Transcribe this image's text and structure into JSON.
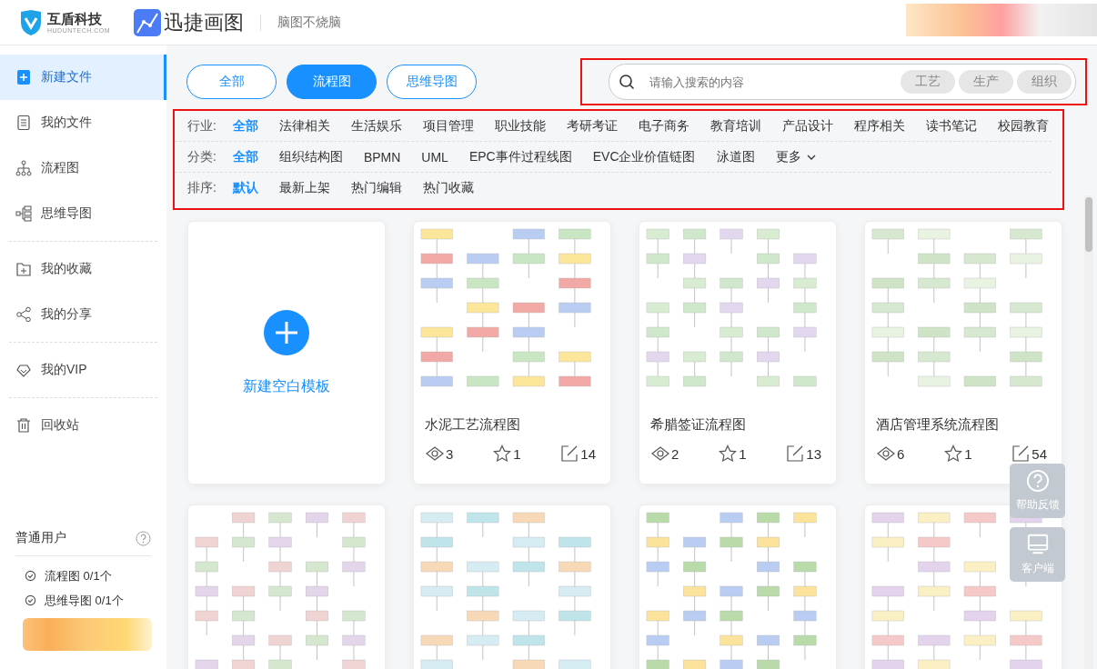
{
  "header": {
    "company_name": "互盾科技",
    "company_domain": "HUDUNTECH.COM",
    "app_name": "迅捷画图",
    "slogan": "脑图不烧脑"
  },
  "sidebar": {
    "groups": [
      [
        {
          "label": "新建文件",
          "selected": true
        },
        {
          "label": "我的文件",
          "selected": false
        },
        {
          "label": "流程图",
          "selected": false
        },
        {
          "label": "思维导图",
          "selected": false
        }
      ],
      [
        {
          "label": "我的收藏",
          "selected": false
        },
        {
          "label": "我的分享",
          "selected": false
        }
      ],
      [
        {
          "label": "我的VIP",
          "selected": false
        }
      ],
      [
        {
          "label": "回收站",
          "selected": false
        }
      ]
    ],
    "user_panel": {
      "title": "普通用户",
      "quotas": [
        "流程图 0/1个",
        "思维导图 0/1个"
      ]
    }
  },
  "type_tabs": [
    {
      "label": "全部",
      "selected": false
    },
    {
      "label": "流程图",
      "selected": true
    },
    {
      "label": "思维导图",
      "selected": false
    }
  ],
  "search": {
    "placeholder": "请输入搜索的内容",
    "tags": [
      "工艺",
      "生产",
      "组织"
    ]
  },
  "filters": [
    {
      "label": "行业:",
      "options": [
        {
          "label": "全部",
          "selected": true
        },
        {
          "label": "法律相关",
          "selected": false
        },
        {
          "label": "生活娱乐",
          "selected": false
        },
        {
          "label": "项目管理",
          "selected": false
        },
        {
          "label": "职业技能",
          "selected": false
        },
        {
          "label": "考研考证",
          "selected": false
        },
        {
          "label": "电子商务",
          "selected": false
        },
        {
          "label": "教育培训",
          "selected": false
        },
        {
          "label": "产品设计",
          "selected": false
        },
        {
          "label": "程序相关",
          "selected": false
        },
        {
          "label": "读书笔记",
          "selected": false
        },
        {
          "label": "校园教育",
          "selected": false
        }
      ]
    },
    {
      "label": "分类:",
      "options": [
        {
          "label": "全部",
          "selected": true
        },
        {
          "label": "组织结构图",
          "selected": false
        },
        {
          "label": "BPMN",
          "selected": false
        },
        {
          "label": "UML",
          "selected": false
        },
        {
          "label": "EPC事件过程线图",
          "selected": false
        },
        {
          "label": "EVC企业价值链图",
          "selected": false
        },
        {
          "label": "泳道图",
          "selected": false
        }
      ],
      "more": "更多"
    },
    {
      "label": "排序:",
      "options": [
        {
          "label": "默认",
          "selected": true
        },
        {
          "label": "最新上架",
          "selected": false
        },
        {
          "label": "热门编辑",
          "selected": false
        },
        {
          "label": "热门收藏",
          "selected": false
        }
      ]
    }
  ],
  "cards": [
    {
      "kind": "new",
      "label": "新建空白模板"
    },
    {
      "kind": "template",
      "title": "水泥工艺流程图",
      "views": "3",
      "stars": "1",
      "edits": "14"
    },
    {
      "kind": "template",
      "title": "希腊签证流程图",
      "views": "2",
      "stars": "1",
      "edits": "13"
    },
    {
      "kind": "template",
      "title": "酒店管理系统流程图",
      "views": "6",
      "stars": "1",
      "edits": "54"
    },
    {
      "kind": "template"
    },
    {
      "kind": "template"
    },
    {
      "kind": "template"
    },
    {
      "kind": "template"
    }
  ],
  "float_buttons": [
    "帮助反馈",
    "客户端"
  ]
}
